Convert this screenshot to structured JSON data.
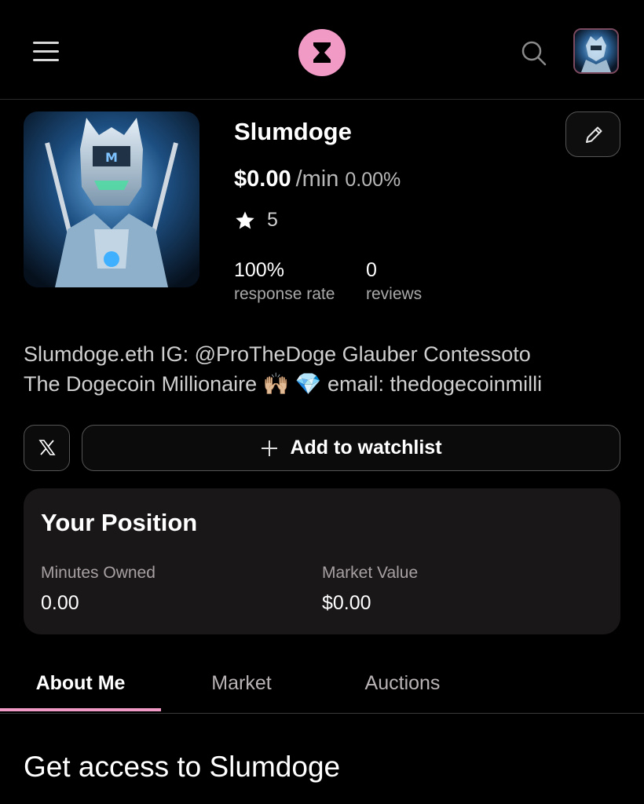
{
  "header": {
    "menu_icon": "hamburger-menu-icon",
    "logo_icon": "hourglass-logo-icon",
    "search_icon": "search-icon",
    "brand_color": "#f19ac6"
  },
  "profile": {
    "name": "Slumdoge",
    "price": "$0.00",
    "per_unit": "/min",
    "change": "0.00%",
    "rating": "5",
    "response_rate": "100%",
    "response_rate_label": "response rate",
    "reviews": "0",
    "reviews_label": "reviews",
    "bio_line1": "Slumdoge.eth IG: @ProTheDoge Glauber Contessoto",
    "bio_line2_text": "The Dogecoin Millionaire",
    "bio_emoji1": "🙌🏼",
    "bio_emoji2": "💎",
    "bio_line2_end": "email: thedogecoinmilli"
  },
  "actions": {
    "x_icon": "x-logo-icon",
    "watchlist_label": "Add to watchlist"
  },
  "position": {
    "title": "Your Position",
    "minutes_label": "Minutes Owned",
    "minutes_value": "0.00",
    "market_label": "Market Value",
    "market_value": "$0.00"
  },
  "tabs": [
    {
      "label": "About Me",
      "active": true
    },
    {
      "label": "Market",
      "active": false
    },
    {
      "label": "Auctions",
      "active": false
    }
  ],
  "section": {
    "title": "Get access to Slumdoge"
  }
}
